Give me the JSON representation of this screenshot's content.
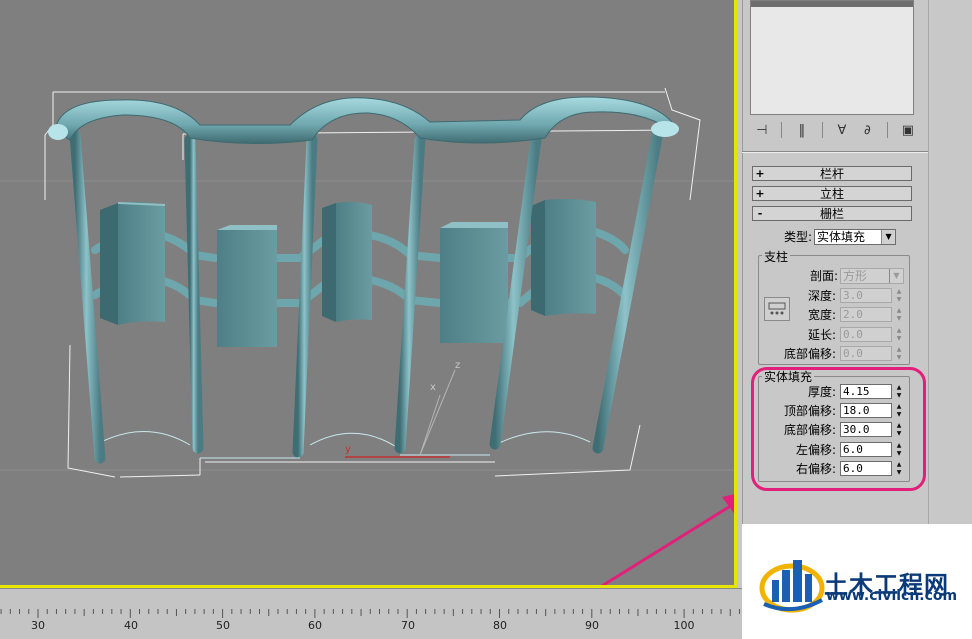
{
  "timeline": {
    "ticks": [
      "30",
      "40",
      "50",
      "60",
      "70",
      "80",
      "90",
      "100"
    ]
  },
  "panel": {
    "rollouts": {
      "railing": {
        "sign": "+",
        "title": "栏杆"
      },
      "posts": {
        "sign": "+",
        "title": "立柱"
      },
      "fencing": {
        "sign": "-",
        "title": "栅栏"
      }
    },
    "type_label": "类型:",
    "type_value": "实体填充",
    "support": {
      "group_title": "支柱",
      "profile_label": "剖面:",
      "profile_value": "方形",
      "depth_label": "深度:",
      "depth_value": "3.0",
      "width_label": "宽度:",
      "width_value": "2.0",
      "extension_label": "延长:",
      "extension_value": "0.0",
      "bottom_offset_label": "底部偏移:",
      "bottom_offset_value": "0.0"
    },
    "solid_fill": {
      "group_title": "实体填充",
      "thickness_label": "厚度:",
      "thickness_value": "4.15",
      "top_offset_label": "顶部偏移:",
      "top_offset_value": "18.0",
      "bottom_offset_label": "底部偏移:",
      "bottom_offset_value": "30.0",
      "left_offset_label": "左偏移:",
      "left_offset_value": "6.0",
      "right_offset_label": "右偏移:",
      "right_offset_value": "6.0"
    },
    "highlight_color": "#e0207a"
  },
  "logo": {
    "name": "土木工程网",
    "url": "www.civilcn.com"
  },
  "viewport": {
    "axis_x": "x",
    "axis_y": "y",
    "axis_z": "z"
  }
}
